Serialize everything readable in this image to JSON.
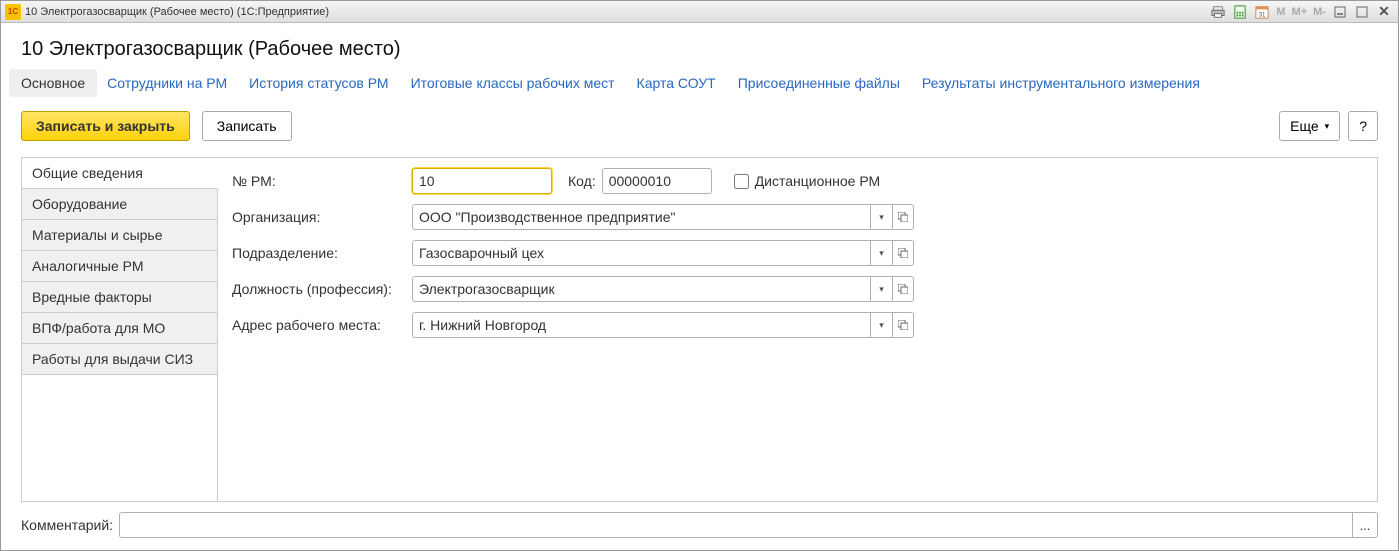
{
  "window": {
    "title": "10 Электрогазосварщик (Рабочее место)  (1С:Предприятие)",
    "logo_text": "1C"
  },
  "titlebar_icons": {
    "m": "M",
    "mplus": "M+",
    "mminus": "M-"
  },
  "page_title": "10 Электрогазосварщик (Рабочее место)",
  "tabs": [
    {
      "label": "Основное",
      "active": true
    },
    {
      "label": "Сотрудники на РМ",
      "active": false
    },
    {
      "label": "История статусов РМ",
      "active": false
    },
    {
      "label": "Итоговые классы рабочих мест",
      "active": false
    },
    {
      "label": "Карта СОУТ",
      "active": false
    },
    {
      "label": "Присоединенные файлы",
      "active": false
    },
    {
      "label": "Результаты инструментального измерения",
      "active": false
    }
  ],
  "toolbar": {
    "save_close": "Записать и закрыть",
    "save": "Записать",
    "more": "Еще",
    "help": "?"
  },
  "side_tabs": [
    {
      "label": "Общие сведения",
      "active": true
    },
    {
      "label": "Оборудование",
      "active": false
    },
    {
      "label": "Материалы и сырье",
      "active": false
    },
    {
      "label": "Аналогичные РМ",
      "active": false
    },
    {
      "label": "Вредные факторы",
      "active": false
    },
    {
      "label": "ВПФ/работа для МО",
      "active": false
    },
    {
      "label": "Работы для выдачи СИЗ",
      "active": false
    }
  ],
  "form": {
    "rm_no_label": "№ РМ:",
    "rm_no_value": "10",
    "code_label": "Код:",
    "code_value": "00000010",
    "remote_label": "Дистанционное РМ",
    "remote_checked": false,
    "org_label": "Организация:",
    "org_value": "ООО \"Производственное предприятие\"",
    "dept_label": "Подразделение:",
    "dept_value": "Газосварочный цех",
    "position_label": "Должность (профессия):",
    "position_value": "Электрогазосварщик",
    "address_label": "Адрес рабочего места:",
    "address_value": "г. Нижний Новгород"
  },
  "comment": {
    "label": "Комментарий:",
    "value": "",
    "btn": "..."
  }
}
